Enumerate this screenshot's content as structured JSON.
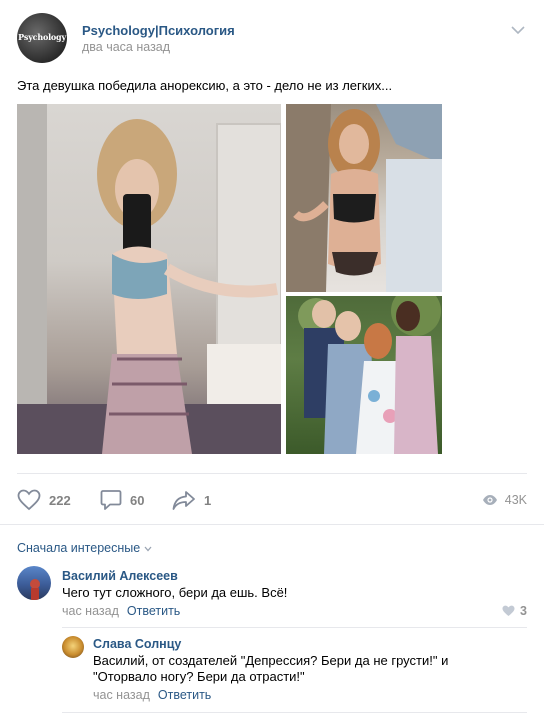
{
  "post": {
    "author": "Psychology|Психология",
    "avatar_text": "Psychology",
    "time": "два часа назад",
    "text": "Эта девушка победила анорексию, а это - дело не из легких...",
    "photos": [
      "photo-main",
      "photo-beach",
      "photo-wedding"
    ]
  },
  "actions": {
    "likes": "222",
    "comments": "60",
    "shares": "1",
    "views": "43K"
  },
  "comments_section": {
    "sort_label": "Сначала интересные",
    "comments": [
      {
        "author": "Василий Алексеев",
        "text": "Чего тут сложного, бери да ешь. Всё!",
        "time": "час назад",
        "reply_label": "Ответить",
        "likes": "3"
      }
    ],
    "replies": [
      {
        "author": "Слава Солнцу",
        "text": "Василий, от создателей \"Депрессия? Бери да не грусти!\" и \"Оторвало ногу? Бери да отрасти!\"",
        "time": "час назад",
        "reply_label": "Ответить"
      }
    ]
  },
  "colors": {
    "link": "#2a5885",
    "muted": "#939393",
    "divider": "#e7e8ec",
    "icon": "#828a99"
  },
  "icons": [
    "chevron-down-icon",
    "heart-icon",
    "comment-icon",
    "share-icon",
    "eye-icon"
  ]
}
